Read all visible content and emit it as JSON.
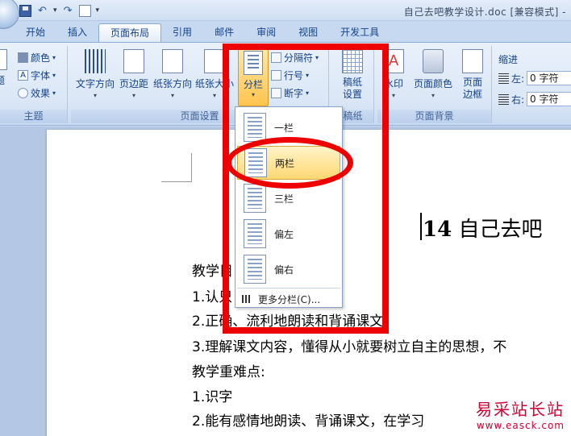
{
  "window": {
    "title": "自己去吧教学设计.doc [兼容模式] -"
  },
  "tabs": [
    "开始",
    "插入",
    "页面布局",
    "引用",
    "邮件",
    "审阅",
    "视图",
    "开发工具"
  ],
  "active_tab": "页面布局",
  "ribbon": {
    "theme": {
      "label": "主题",
      "colors": "颜色",
      "fonts": "字体",
      "effects": "效果",
      "theme_btn": "题"
    },
    "page_setup": {
      "label": "页面设置",
      "text_dir": "文字方向",
      "margins": "页边距",
      "orientation": "纸张方向",
      "size": "纸张大小",
      "columns": "分栏",
      "breaks": "分隔符",
      "line_numbers": "行号",
      "hyphenation": "断字"
    },
    "manuscript": {
      "label": "稿纸",
      "settings": "稿纸设置"
    },
    "page_bg": {
      "label": "页面背景",
      "watermark": "水印",
      "page_color": "页面颜色",
      "page_border": "页面边框"
    },
    "paragraph": {
      "indent": "缩进",
      "left": "左:",
      "right": "右:",
      "left_val": "0 字符",
      "right_val": "0 字符"
    }
  },
  "columns_menu": {
    "items": [
      "一栏",
      "两栏",
      "三栏",
      "偏左",
      "偏右"
    ],
    "highlighted": "两栏",
    "more": "更多分栏(C)..."
  },
  "document": {
    "heading_num": "14",
    "heading_text": "自己去吧",
    "lines": [
      "教学目",
      "1.认只",
      "2.正确、流利地朗读和背诵课文。",
      "3.理解课文内容，懂得从小就要树立自主的思想，不",
      "教学重难点:",
      "1.识字",
      "2.能有感情地朗读、背诵课文，在学习"
    ]
  },
  "watermark": {
    "cn": "易采站长站",
    "url": "www.easck.com"
  }
}
